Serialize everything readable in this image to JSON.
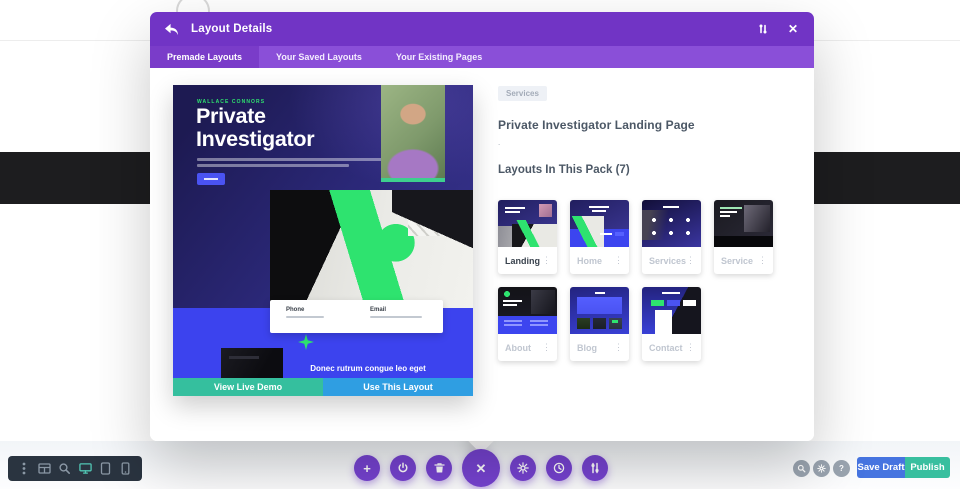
{
  "modal": {
    "title": "Layout Details",
    "tabs": [
      {
        "label": "Premade Layouts",
        "active": true
      },
      {
        "label": "Your Saved Layouts",
        "active": false
      },
      {
        "label": "Your Existing Pages",
        "active": false
      }
    ],
    "details": {
      "category": "Services",
      "title": "Private Investigator Landing Page",
      "description": ".",
      "pack_heading": "Layouts In This Pack (7)",
      "layouts": [
        {
          "label": "Landing",
          "active": true
        },
        {
          "label": "Home",
          "active": false
        },
        {
          "label": "Services",
          "active": false
        },
        {
          "label": "Service",
          "active": false
        },
        {
          "label": "About",
          "active": false
        },
        {
          "label": "Blog",
          "active": false
        },
        {
          "label": "Contact",
          "active": false
        }
      ]
    },
    "preview": {
      "eyebrow": "WALLACE CONNORS",
      "heading": "Private Investigator",
      "phone_label": "Phone",
      "email_label": "Email",
      "tagline": "Donec rutrum congue leo eget",
      "demo_button": "View Live Demo",
      "use_button": "Use This Layout"
    },
    "header_icons": [
      "back-icon",
      "sort-icon",
      "close-icon"
    ]
  },
  "footer": {
    "save_draft": "Save Draft",
    "publish": "Publish",
    "help": "?",
    "toolbar_icons": [
      "more-vertical-icon",
      "wireframe-icon",
      "zoom-icon",
      "desktop-icon",
      "tablet-icon",
      "phone-icon"
    ],
    "builder_icons": [
      "plus-icon",
      "power-icon",
      "trash-icon",
      "close-icon",
      "gear-icon",
      "history-icon",
      "sliders-icon"
    ],
    "utility_icons": [
      "zoom-icon",
      "gear-icon",
      "help-icon"
    ]
  },
  "colors": {
    "header_purple": "#7134c5",
    "tabbar_purple": "#8a4fd8",
    "active_tab_purple": "#7a3cc9",
    "builder_purple": "#7743d2",
    "accent_green": "#2ee36f",
    "blue_section": "#3c43ee",
    "demo_teal": "#35bf9e",
    "use_blue": "#2f9ee2",
    "save_blue": "#4674e0",
    "publish_teal": "#38bf9f",
    "toolbar_dark": "#2a3440",
    "toolbar_active_teal": "#52c6b4",
    "black_band": "#1d1d1f"
  }
}
